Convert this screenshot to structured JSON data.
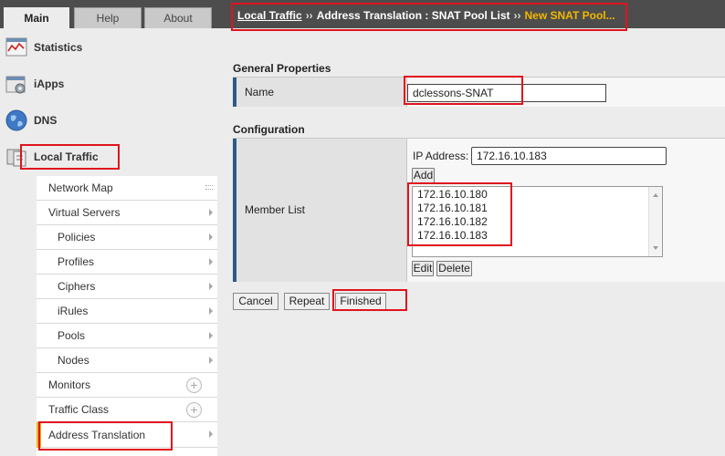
{
  "tabs": {
    "main": "Main",
    "help": "Help",
    "about": "About"
  },
  "nav": {
    "statistics": {
      "label": "Statistics",
      "icon": "statistics-chart-icon"
    },
    "iapps": {
      "label": "iApps",
      "icon": "iapps-gear-icon"
    },
    "dns": {
      "label": "DNS",
      "icon": "dns-globe-icon"
    },
    "local_traffic": {
      "label": "Local Traffic",
      "icon": "local-traffic-icon"
    }
  },
  "submenu": {
    "network_map": "Network Map",
    "virtual_servers": "Virtual Servers",
    "policies": "Policies",
    "profiles": "Profiles",
    "ciphers": "Ciphers",
    "irules": "iRules",
    "pools": "Pools",
    "nodes": "Nodes",
    "monitors": "Monitors",
    "traffic_class": "Traffic Class",
    "address_translation": "Address Translation"
  },
  "breadcrumb": {
    "root": "Local Traffic",
    "sep1": "››",
    "middle": "Address Translation : SNAT Pool List",
    "sep2": "››",
    "current": "New SNAT Pool..."
  },
  "general": {
    "heading": "General Properties",
    "name_label": "Name",
    "name_value": "dclessons-SNAT"
  },
  "configuration": {
    "heading": "Configuration",
    "member_label": "Member List",
    "ip_label": "IP Address:",
    "ip_value": "172.16.10.183",
    "add_button": "Add",
    "members": [
      "172.16.10.180",
      "172.16.10.181",
      "172.16.10.182",
      "172.16.10.183"
    ],
    "edit_button": "Edit",
    "delete_button": "Delete"
  },
  "actions": {
    "cancel": "Cancel",
    "repeat": "Repeat",
    "finished": "Finished"
  },
  "colors": {
    "accent_blue": "#2f5a86",
    "highlight_red": "#e0141e",
    "active_yellow": "#f0b400",
    "header_dark": "#4d4d4d"
  }
}
